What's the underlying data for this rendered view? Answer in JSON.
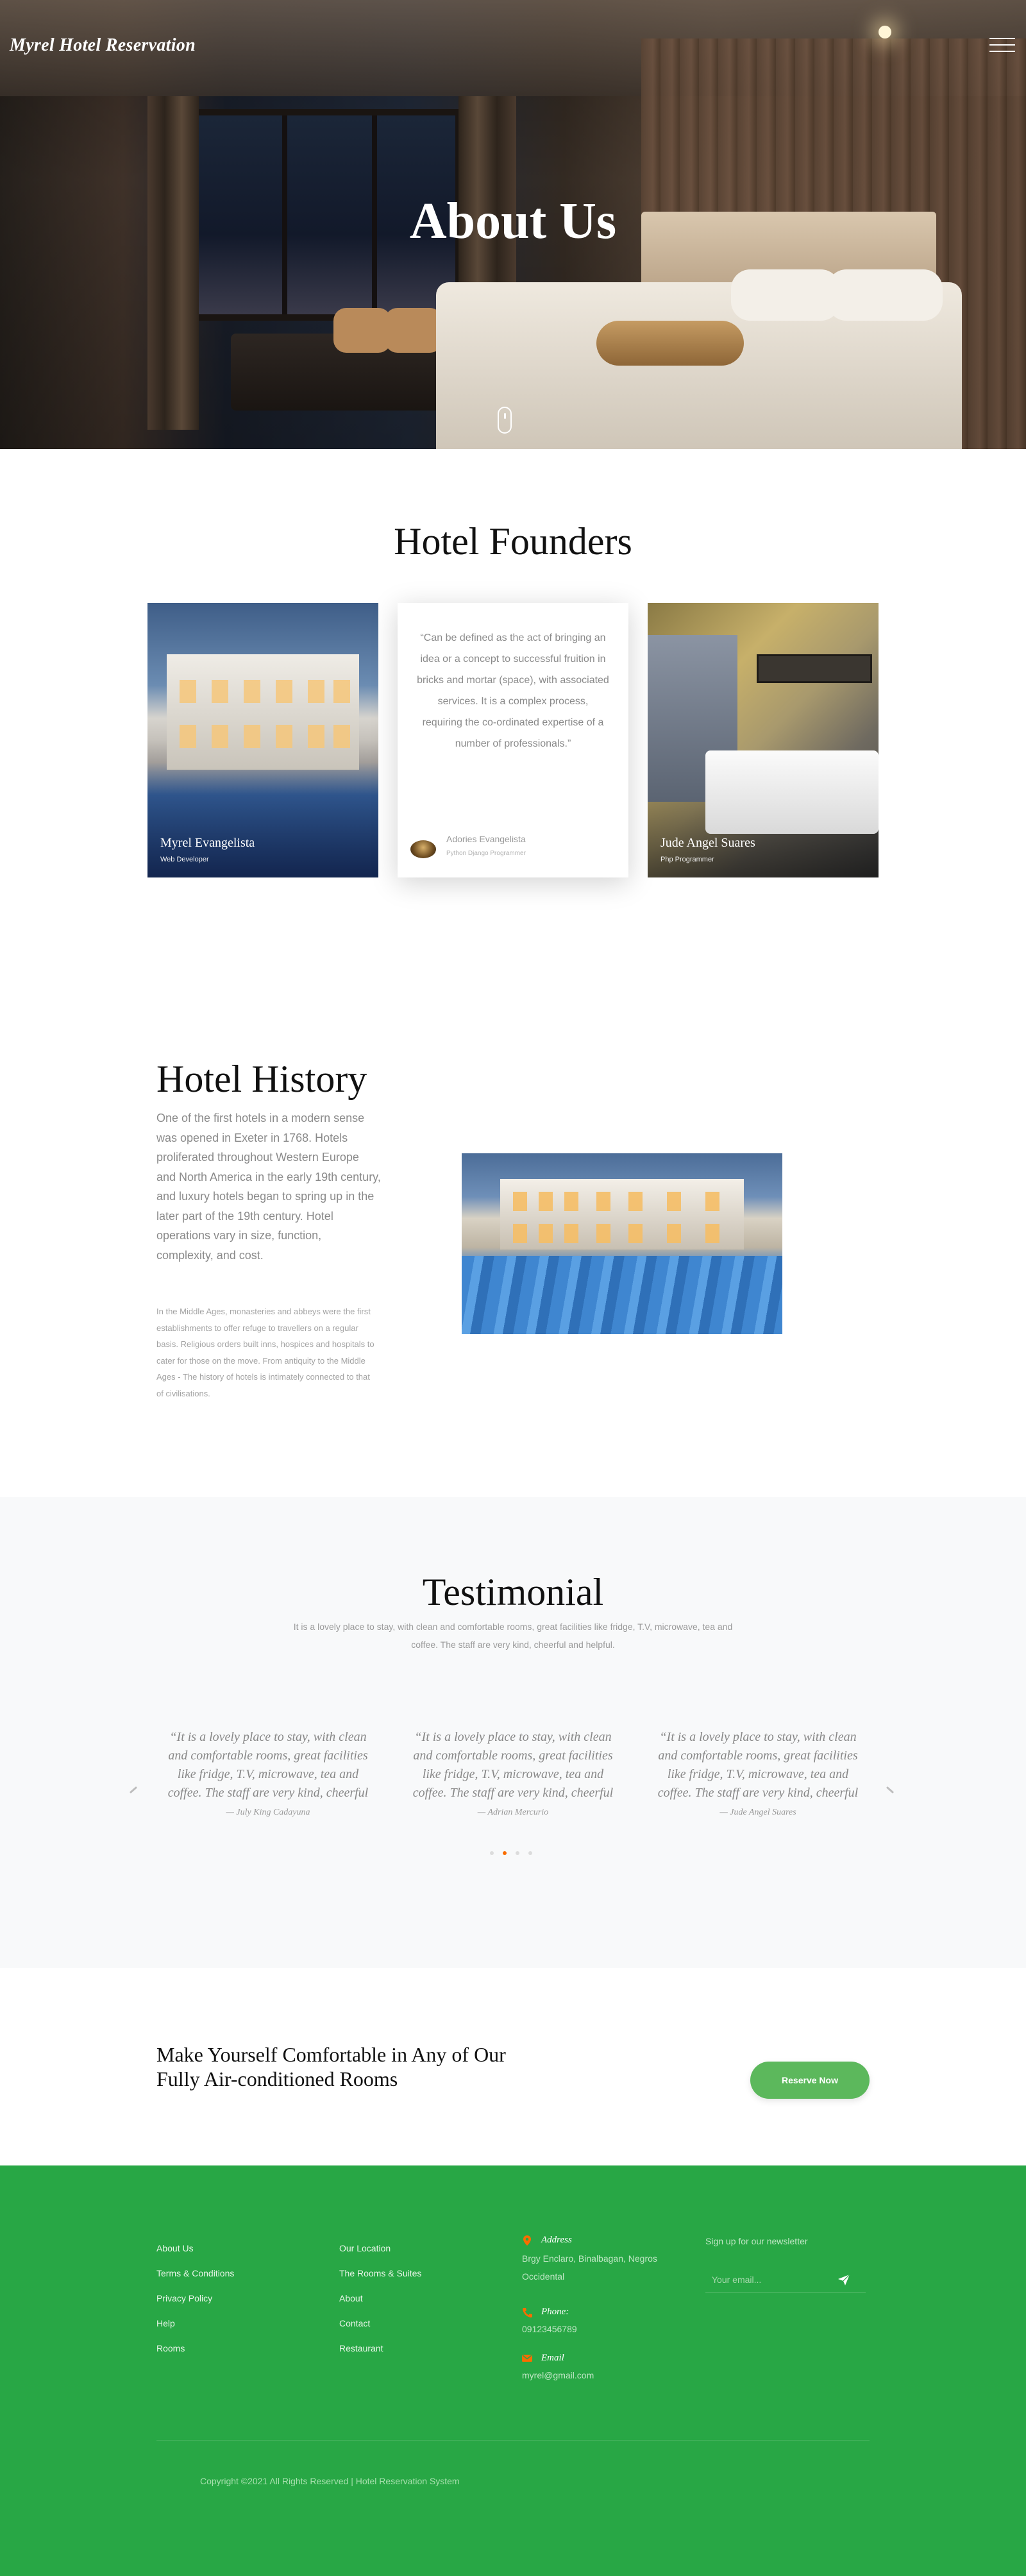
{
  "header": {
    "brand": "Myrel Hotel Reservation",
    "menu_icon": "hamburger-menu-icon"
  },
  "hero": {
    "title": "About Us",
    "scroll_icon": "mouse-scroll-icon"
  },
  "founders": {
    "title": "Hotel Founders",
    "cards": [
      {
        "name": "Myrel Evangelista",
        "role": "Web Developer"
      },
      {
        "name": "Jude Angel Suares",
        "role": "Php Programmer"
      }
    ],
    "quote": {
      "text": "“Can be defined as the act of bringing an idea or a concept to successful fruition in bricks and mortar (space), with associated services. It is a complex process, requiring the co-ordinated expertise of a number of professionals.”",
      "name": "Adories Evangelista",
      "role": "Python Django Programmer"
    }
  },
  "history": {
    "title": "Hotel History",
    "lead": "One of the first hotels in a modern sense was opened in Exeter in 1768. Hotels proliferated throughout Western Europe and North America in the early 19th century, and luxury hotels began to spring up in the later part of the 19th century. Hotel operations vary in size, function, complexity, and cost.",
    "sub": "In the Middle Ages, monasteries and abbeys were the first establishments to offer refuge to travellers on a regular basis. Religious orders built inns, hospices and hospitals to cater for those on the move. From antiquity to the Middle Ages - The history of hotels is intimately connected to that of civilisations."
  },
  "testimonial": {
    "title": "Testimonial",
    "subtitle": "It is a lovely place to stay, with clean and comfortable rooms, great facilities like fridge, T.V, microwave, tea and coffee. The staff are very kind, cheerful and helpful.",
    "items": [
      {
        "quote": "“It is a lovely place to stay, with clean and comfortable rooms, great facilities like fridge, T.V, microwave, tea and coffee. The staff are very kind, cheerful and helpful.”",
        "author": "— July King Cadayuna"
      },
      {
        "quote": "“It is a lovely place to stay, with clean and comfortable rooms, great facilities like fridge, T.V, microwave, tea and coffee. The staff are very kind, cheerful and helpful.”",
        "author": "— Adrian Mercurio"
      },
      {
        "quote": "“It is a lovely place to stay, with clean and comfortable rooms, great facilities like fridge, T.V, microwave, tea and coffee. The staff are very kind, cheerful and helpful.”",
        "author": "— Jude Angel Suares"
      }
    ],
    "active_dot": 1,
    "dot_count": 4
  },
  "cta": {
    "text": "Make Yourself Comfortable in Any of Our Fully Air-conditioned Rooms",
    "button": "Reserve Now"
  },
  "footer": {
    "col1": [
      "About Us",
      "Terms & Conditions",
      "Privacy Policy",
      "Help",
      "Rooms"
    ],
    "col2": [
      "Our Location",
      "The Rooms & Suites",
      "About",
      "Contact",
      "Restaurant"
    ],
    "address_label": "Address",
    "address": "Brgy Enclaro, Binalbagan, Negros Occidental",
    "phone_label": "Phone:",
    "phone": "09123456789",
    "email_label": "Email",
    "email": "myrel@gmail.com",
    "newsletter_title": "Sign up for our newsletter",
    "newsletter_placeholder": "Your email...",
    "copyright": "Copyright ©2021 All Rights Reserved | Hotel Reservation System"
  },
  "colors": {
    "accent_orange": "#f96d00",
    "footer_green": "#28a745",
    "button_green": "#5cb85c"
  }
}
